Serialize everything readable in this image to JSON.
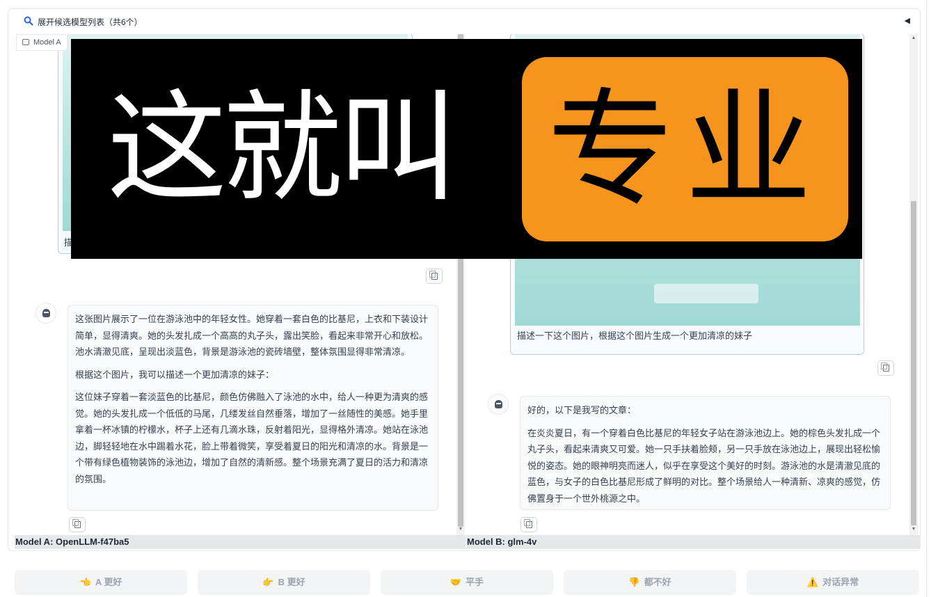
{
  "accordion": {
    "title": "展开候选模型列表（共6个）",
    "toggle": "◀"
  },
  "model_a": {
    "tag": "Model A",
    "caption_partial": "描",
    "response": [
      "这张图片展示了一位在游泳池中的年轻女性。她穿着一套白色的比基尼，上衣和下装设计简单，显得清爽。她的头发扎成一个高高的丸子头，露出笑脸，看起来非常开心和放松。池水清澈见底，呈现出淡蓝色，背景是游泳池的瓷砖墙壁，整体氛围显得非常清凉。",
      "根据这个图片，我可以描述一个更加清凉的妹子：",
      "这位妹子穿着一套淡蓝色的比基尼，颜色仿佛融入了泳池的水中，给人一种更为清爽的感觉。她的头发扎成一个低低的马尾，几缕发丝自然垂落，增加了一丝随性的美感。她手里拿着一杯冰镇的柠檬水，杯子上还有几滴水珠，反射着阳光，显得格外清凉。她站在泳池边，脚轻轻地在水中踢着水花，脸上带着微笑，享受着夏日的阳光和清凉的水。背景是一个带有绿色植物装饰的泳池边，增加了自然的清新感。整个场景充满了夏日的活力和清凉的氛围。"
    ],
    "label": "Model A: OpenLLM-f47ba5"
  },
  "model_b": {
    "caption": "描述一下这个图片，根据这个图片生成一个更加清凉的妹子",
    "response": [
      "好的，以下是我写的文章：",
      "在炎炎夏日，有一个穿着白色比基尼的年轻女子站在游泳池边上。她的棕色头发扎成一个丸子头，看起来清爽又可爱。她一只手扶着脸颊，另一只手放在泳池边上，展现出轻松愉悦的姿态。她的眼神明亮而迷人，似乎在享受这个美好的时刻。游泳池的水是清澈见底的蓝色，与女子的白色比基尼形成了鲜明的对比。整个场景给人一种清新、凉爽的感觉，仿佛置身于一个世外桃源之中。"
    ],
    "label": "Model B: glm-4v"
  },
  "overlay": {
    "left_text": "这就叫",
    "right_text": "专业",
    "accent": "#f7941d"
  },
  "buttons": [
    {
      "emoji": "👈",
      "label": "A 更好"
    },
    {
      "emoji": "👉",
      "label": "B 更好"
    },
    {
      "emoji": "🤝",
      "label": "平手"
    },
    {
      "emoji": "👎",
      "label": "都不好"
    },
    {
      "emoji": "⚠️",
      "label": "对话异常"
    }
  ]
}
